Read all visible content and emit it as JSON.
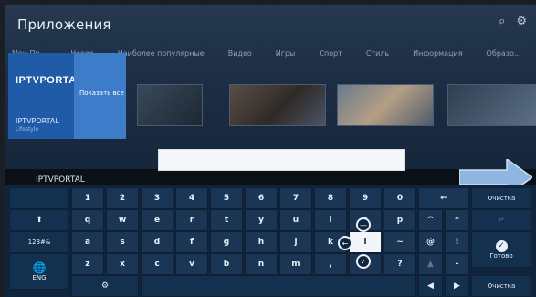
{
  "app": {
    "title": "Приложения"
  },
  "top_icons": [
    "search-icon",
    "settings-icon"
  ],
  "categories": [
    "Мои Пр...",
    "Новое",
    "Наиболее популярные",
    "Видео",
    "Игры",
    "Спорт",
    "Стиль",
    "Информация",
    "Образо..."
  ],
  "featured_tile": {
    "logo": "IPTVPORTAL",
    "caption": "IPTVPORTAL",
    "subcaption": "Lifestyle",
    "show_all": "Показать все"
  },
  "search": {
    "value": ""
  },
  "input_label": "IPTVPORTAL",
  "keyboard": {
    "row1": [
      "1",
      "2",
      "3",
      "4",
      "5",
      "6",
      "7",
      "8",
      "9",
      "0",
      "←",
      "Очистка"
    ],
    "row2": [
      "q",
      "w",
      "e",
      "r",
      "t",
      "y",
      "u",
      "i",
      "o",
      "p",
      "^",
      "*"
    ],
    "row3": [
      "a",
      "s",
      "d",
      "f",
      "g",
      "h",
      "j",
      "k",
      "l",
      "~",
      "@",
      "!"
    ],
    "row4": [
      "z",
      "x",
      "c",
      "v",
      "b",
      "n",
      "m",
      ",",
      ".",
      "?",
      "▲",
      "-"
    ],
    "shift": "⬆",
    "mode_label": "123#&",
    "lang_label": "ENG",
    "done_label": "Готово",
    "clear_bottom": "Очистка"
  }
}
